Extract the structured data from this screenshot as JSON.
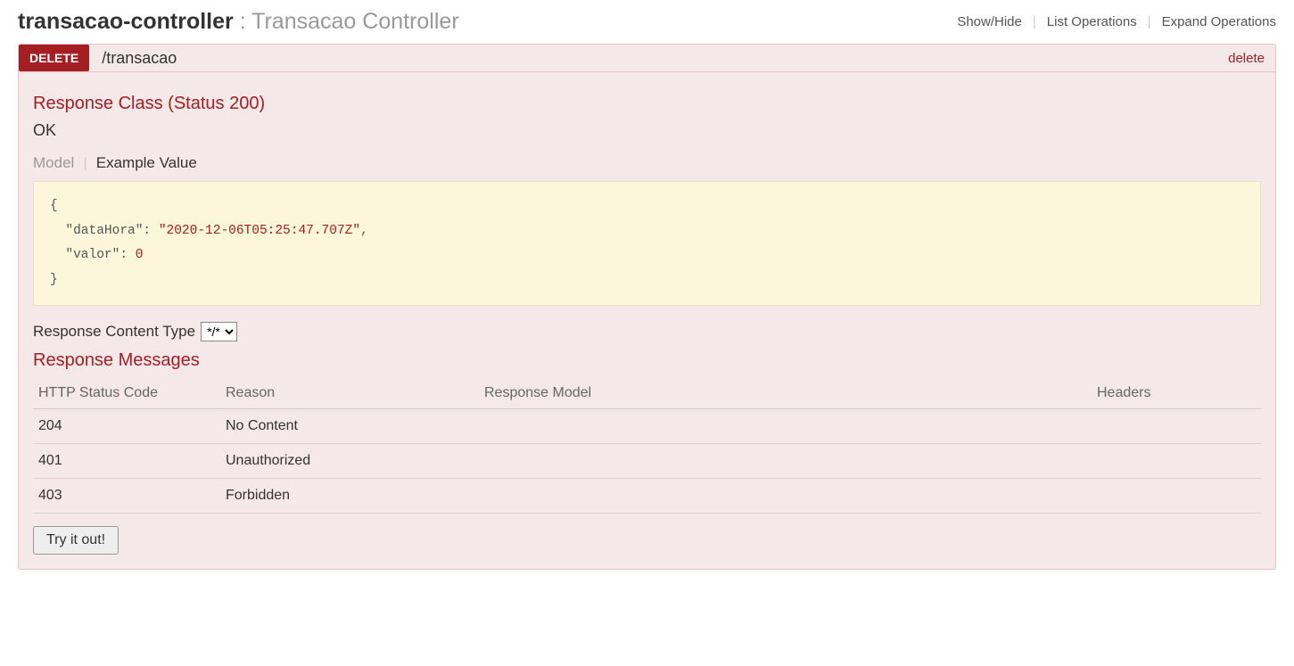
{
  "header": {
    "name": "transacao-controller",
    "sep": " : ",
    "desc": "Transacao Controller",
    "actions": {
      "show_hide": "Show/Hide",
      "list_ops": "List Operations",
      "expand_ops": "Expand Operations"
    }
  },
  "operation": {
    "method": "DELETE",
    "path": "/transacao",
    "summary": "delete"
  },
  "response_class": {
    "heading": "Response Class (Status 200)",
    "status_text": "OK",
    "tabs": {
      "model": "Model",
      "example": "Example Value"
    },
    "example_json": {
      "key1": "\"dataHora\"",
      "val1": "\"2020-12-06T05:25:47.707Z\"",
      "key2": "\"valor\"",
      "val2": "0"
    }
  },
  "content_type": {
    "label": "Response Content Type",
    "selected": "*/*"
  },
  "response_messages": {
    "heading": "Response Messages",
    "columns": {
      "code": "HTTP Status Code",
      "reason": "Reason",
      "model": "Response Model",
      "headers": "Headers"
    },
    "rows": [
      {
        "code": "204",
        "reason": "No Content"
      },
      {
        "code": "401",
        "reason": "Unauthorized"
      },
      {
        "code": "403",
        "reason": "Forbidden"
      }
    ]
  },
  "try_button": "Try it out!"
}
